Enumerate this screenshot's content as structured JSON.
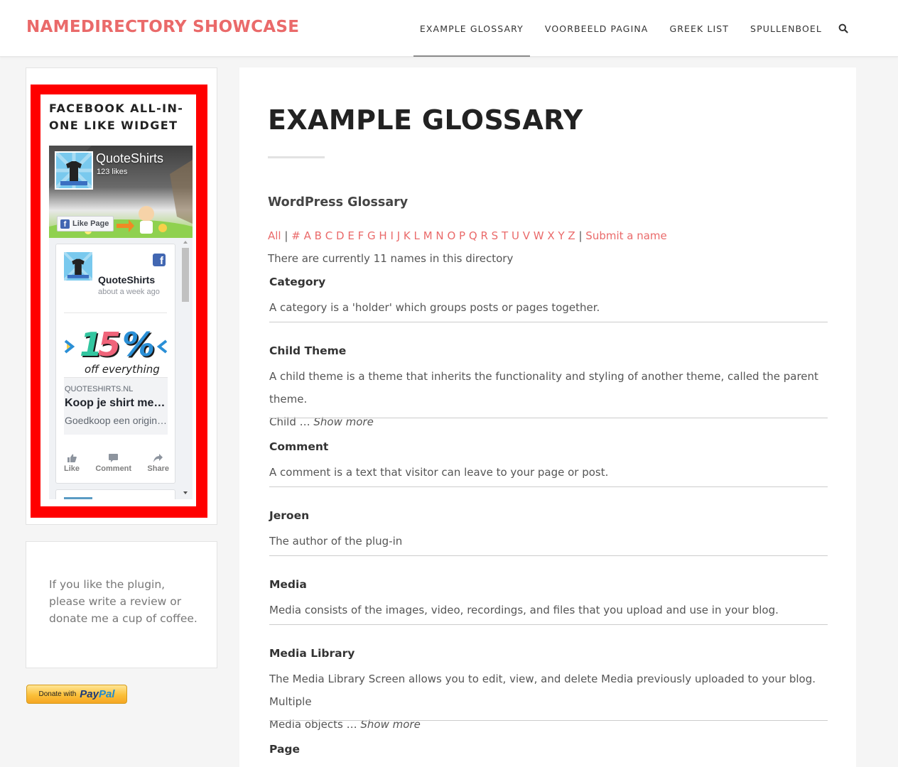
{
  "header": {
    "site_title": "NAMEDIRECTORY SHOWCASE",
    "nav": [
      {
        "label": "EXAMPLE GLOSSARY",
        "active": true
      },
      {
        "label": "VOORBEELD PAGINA",
        "active": false
      },
      {
        "label": "GREEK LIST",
        "active": false
      },
      {
        "label": "SPULLENBOEL",
        "active": false
      }
    ],
    "search_icon": "search-icon"
  },
  "sidebar": {
    "fb_widget": {
      "title": "FACEBOOK ALL-IN-ONE LIKE WIDGET",
      "page_name": "QuoteShirts",
      "likes": "123 likes",
      "like_button": "Like Page",
      "post": {
        "author": "QuoteShirts",
        "time": "about a week ago",
        "link_domain": "QUOTESHIRTS.NL",
        "link_title": "Koop je shirt met quote bij QuoteShirts",
        "link_desc": "Goedkoop een origineel shirt",
        "actions": [
          "Like",
          "Comment",
          "Share"
        ]
      }
    },
    "donate": {
      "text": "If you like the plugin, please write a review or donate me a cup of coffee.",
      "button_small": "Donate with",
      "button_pay": "Pay",
      "button_pal": "Pal"
    }
  },
  "main": {
    "page_title": "EXAMPLE GLOSSARY",
    "glossary_heading": "WordPress Glossary",
    "alphabet": {
      "all": "All",
      "letters": [
        "#",
        "A",
        "B",
        "C",
        "D",
        "E",
        "F",
        "G",
        "H",
        "I",
        "J",
        "K",
        "L",
        "M",
        "N",
        "O",
        "P",
        "Q",
        "R",
        "S",
        "T",
        "U",
        "V",
        "W",
        "X",
        "Y",
        "Z"
      ],
      "submit": "Submit a name"
    },
    "count_text": "There are currently 11 names in this directory",
    "entries": [
      {
        "name": "Category",
        "desc": "A category is a 'holder' which groups posts or pages together.",
        "desc2": "",
        "more": ""
      },
      {
        "name": "Child Theme",
        "desc": "A child theme is a theme that inherits the functionality and styling of another theme, called the parent theme.",
        "desc2": "Child  … ",
        "more": "Show more"
      },
      {
        "name": "Comment",
        "desc": "A comment is a text that visitor can leave to your page or post.",
        "desc2": "",
        "more": ""
      },
      {
        "name": "Jeroen",
        "desc": "The author of the plug-in",
        "desc2": "",
        "more": ""
      },
      {
        "name": "Media",
        "desc": "Media consists of the images, video, recordings, and files that you upload and use in your blog.",
        "desc2": "",
        "more": ""
      },
      {
        "name": "Media Library",
        "desc": "The Media Library Screen allows you to edit, view, and delete Media previously uploaded to your blog. Multiple",
        "desc2": "Media objects  … ",
        "more": "Show more"
      },
      {
        "name": "Page",
        "desc": "",
        "desc2": "",
        "more": ""
      }
    ]
  }
}
